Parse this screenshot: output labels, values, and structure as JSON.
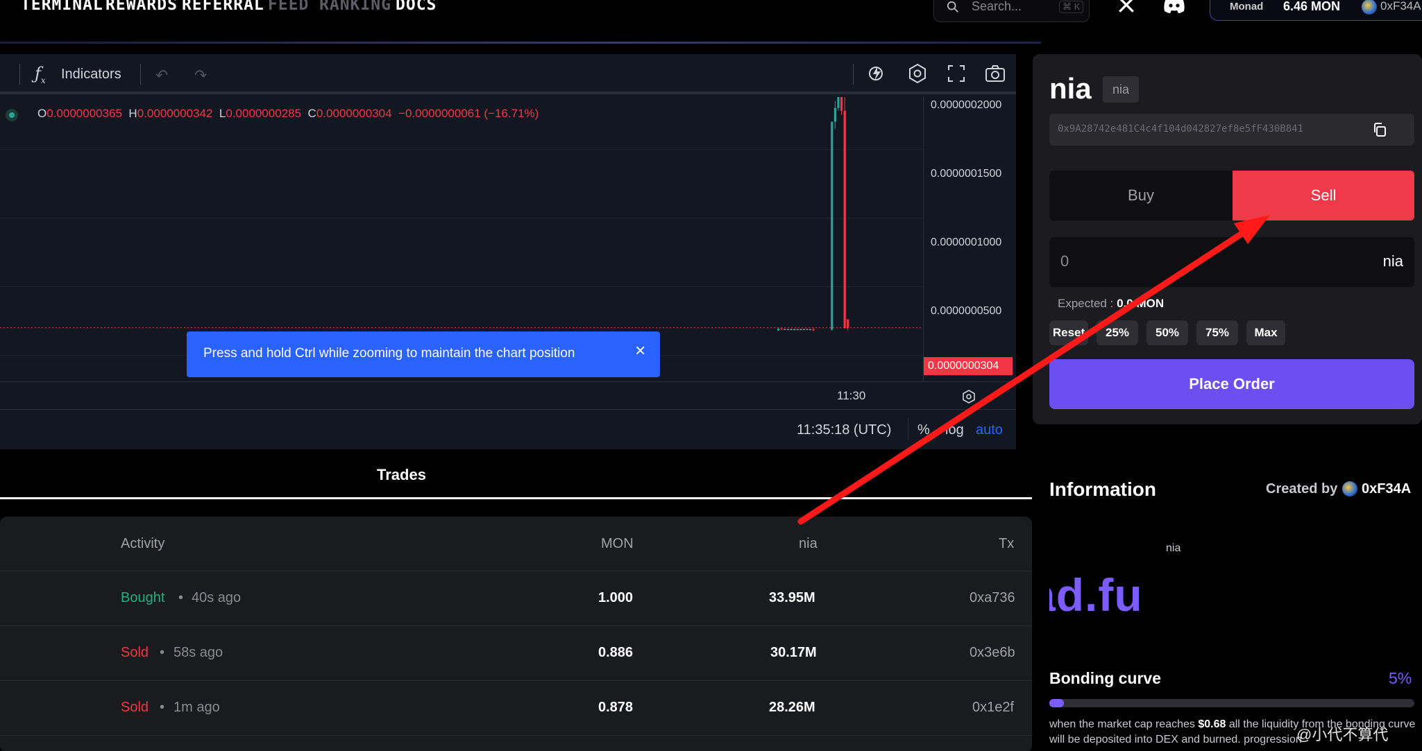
{
  "nav": {
    "links": [
      "TERMINAL",
      "REWARDS",
      "REFERRAL",
      "FEED",
      "RANKING",
      "DOCS"
    ],
    "search_placeholder": "Search...",
    "search_shortcut": "⌘ K",
    "wallet_network": "Monad",
    "wallet_balance": "6.46 MON",
    "wallet_address": "0xF34A"
  },
  "chart": {
    "toolbar": {
      "indicators_label": "Indicators"
    },
    "ohlc": {
      "o_key": "O",
      "o_val": "0.0000000365",
      "h_key": "H",
      "h_val": "0.0000000342",
      "l_key": "L",
      "l_val": "0.0000000285",
      "c_key": "C",
      "c_val": "0.0000000304",
      "change": "−0.0000000061 (−16.71%)"
    },
    "time_label": "11:30",
    "utc_time": "11:35:18 (UTC)",
    "scale_pct": "%",
    "scale_log": "log",
    "scale_auto": "auto",
    "toast_text": "Press and hold Ctrl while zooming to maintain the chart position",
    "toast_close": "×"
  },
  "chart_data": {
    "type": "candlestick",
    "price_ticks": [
      "0.0000002000",
      "0.0000001500",
      "0.0000001000",
      "0.0000000500"
    ],
    "price_range": [
      0.0,
      2.1e-07
    ],
    "last_price": "0.0000000304",
    "last_price_value": 3.04e-08,
    "x_ticks": [
      "11:30"
    ],
    "candles": [
      {
        "o": 2.85e-08,
        "h": 3e-08,
        "l": 2.82e-08,
        "c": 2.98e-08,
        "dir": "up"
      },
      {
        "o": 2.98e-08,
        "h": 3e-08,
        "l": 2.9e-08,
        "c": 2.95e-08,
        "dir": "down"
      },
      {
        "o": 2.95e-08,
        "h": 2.96e-08,
        "l": 2.9e-08,
        "c": 2.93e-08,
        "dir": "flat"
      },
      {
        "o": 2.93e-08,
        "h": 2.96e-08,
        "l": 2.91e-08,
        "c": 2.94e-08,
        "dir": "flat"
      },
      {
        "o": 2.94e-08,
        "h": 2.96e-08,
        "l": 2.91e-08,
        "c": 2.93e-08,
        "dir": "flat"
      },
      {
        "o": 2.93e-08,
        "h": 2.96e-08,
        "l": 2.91e-08,
        "c": 2.94e-08,
        "dir": "flat"
      },
      {
        "o": 2.94e-08,
        "h": 2.96e-08,
        "l": 2.91e-08,
        "c": 2.93e-08,
        "dir": "flat"
      },
      {
        "o": 2.93e-08,
        "h": 2.96e-08,
        "l": 2.91e-08,
        "c": 2.94e-08,
        "dir": "flat"
      },
      {
        "o": 2.94e-08,
        "h": 2.96e-08,
        "l": 2.91e-08,
        "c": 2.95e-08,
        "dir": "flat"
      },
      {
        "o": 2.95e-08,
        "h": 2.96e-08,
        "l": 2.91e-08,
        "c": 2.94e-08,
        "dir": "flat"
      },
      {
        "o": 2.94e-08,
        "h": 2.96e-08,
        "l": 2.91e-08,
        "c": 2.93e-08,
        "dir": "flat"
      },
      {
        "o": 2.93e-08,
        "h": 3.05e-08,
        "l": 2.8e-08,
        "c": 2.9e-08,
        "dir": "down"
      },
      {
        "o": 2.9e-08,
        "h": 1.8e-07,
        "l": 2.85e-08,
        "c": 1.8e-07,
        "dir": "up"
      },
      {
        "o": 1.8e-07,
        "h": 1.95e-07,
        "l": 1.75e-07,
        "c": 1.9e-07,
        "dir": "up"
      },
      {
        "o": 1.9e-07,
        "h": 2e-07,
        "l": 1.88e-07,
        "c": 1.98e-07,
        "dir": "up"
      },
      {
        "o": 1.98e-07,
        "h": 2e-07,
        "l": 1.85e-07,
        "c": 1.88e-07,
        "dir": "down"
      },
      {
        "o": 1.88e-07,
        "h": 1.99e-07,
        "l": 3e-08,
        "c": 3e-08,
        "dir": "down"
      },
      {
        "o": 3.65e-08,
        "h": 3.42e-08,
        "l": 2.85e-08,
        "c": 3.04e-08,
        "dir": "down"
      }
    ]
  },
  "trades": {
    "tab_label": "Trades",
    "headers": {
      "activity": "Activity",
      "mon": "MON",
      "token": "nia",
      "tx": "Tx"
    },
    "rows": [
      {
        "action": "Bought",
        "ago": "40s ago",
        "mon": "1.000",
        "amount": "33.95M",
        "tx": "0xa736",
        "type": "bought"
      },
      {
        "action": "Sold",
        "ago": "58s ago",
        "mon": "0.886",
        "amount": "30.17M",
        "tx": "0x3e6b",
        "type": "sold"
      },
      {
        "action": "Sold",
        "ago": "1m ago",
        "mon": "0.878",
        "amount": "28.26M",
        "tx": "0x1e2f",
        "type": "sold"
      }
    ],
    "separator": "•"
  },
  "order": {
    "token_name": "nia",
    "token_tag": "nia",
    "contract": "0x9A28742e481C4c4f104d042827ef8e5fF430B841",
    "buy_label": "Buy",
    "sell_label": "Sell",
    "amount_value": "0",
    "amount_unit": "nia",
    "expected_label": "Expected :",
    "expected_value": "0.0",
    "expected_unit": "MON",
    "quick": [
      "Reset",
      "25%",
      "50%",
      "75%",
      "Max"
    ],
    "place_order": "Place Order"
  },
  "info": {
    "title": "Information",
    "created_by_label": "Created by",
    "creator": "0xF34A",
    "sub_label": "nia",
    "brand_text": "ad.fu",
    "bonding_title": "Bonding curve",
    "bonding_pct": "5%",
    "bonding_progress": 0.04,
    "desc_pre": "when the market cap reaches ",
    "desc_amount": "$0.68",
    "desc_post": " all the liquidity from the bonding curve will be deposited into DEX and burned. progression"
  },
  "watermark": "@小代不算代",
  "colors": {
    "accent": "#6b4ff0",
    "sell": "#f03a4a",
    "buy_green": "#22b07d",
    "chart_bg": "#131722",
    "candle_up": "#26a69a",
    "candle_down": "#f23645",
    "toast": "#2962ff",
    "arrow": "#ff1a1a"
  }
}
